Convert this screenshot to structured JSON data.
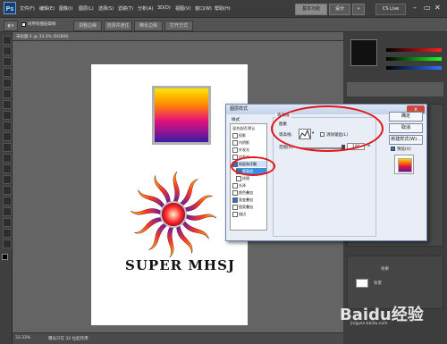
{
  "menubar": {
    "logo": "Ps",
    "items": [
      "文件(F)",
      "编辑(E)",
      "图像(I)",
      "图层(L)",
      "选择(S)",
      "滤镜(T)",
      "分析(A)",
      "3D(D)",
      "视图(V)",
      "窗口(W)",
      "帮助(H)"
    ],
    "workspace": "基本功能",
    "design": "设计",
    "cs_live": "CS Live"
  },
  "options": {
    "sample_all": "对所有图层取样",
    "btn1": "调整边缘",
    "btn2": "选择并遮住",
    "btn3": "精化边缘",
    "btn4": "打开方式"
  },
  "document": {
    "tab": "未标题-1 @ 33.3% (RGB/8)",
    "text": "SUPER MHSJ",
    "zoom": "33.33%",
    "status": "曝光只在 32 位起作用"
  },
  "dialog": {
    "title": "图层样式",
    "close": "x",
    "styles_header": "样式",
    "styles": [
      {
        "label": "混合选项:默认",
        "checked": false,
        "selected": false
      },
      {
        "label": "投影",
        "checked": false,
        "selected": false
      },
      {
        "label": "内阴影",
        "checked": false,
        "selected": false
      },
      {
        "label": "外发光",
        "checked": false,
        "selected": false
      },
      {
        "label": "内发光",
        "checked": false,
        "selected": false
      },
      {
        "label": "斜面和浮雕",
        "checked": true,
        "selected": false
      },
      {
        "label": "等高线",
        "checked": true,
        "selected": true
      },
      {
        "label": "纹理",
        "checked": false,
        "selected": false
      },
      {
        "label": "光泽",
        "checked": false,
        "selected": false
      },
      {
        "label": "颜色叠加",
        "checked": false,
        "selected": false
      },
      {
        "label": "渐变叠加",
        "checked": true,
        "selected": false
      },
      {
        "label": "图案叠加",
        "checked": false,
        "selected": false
      },
      {
        "label": "描边",
        "checked": false,
        "selected": false
      }
    ],
    "section_title": "等高线",
    "section_sub": "图素",
    "contour_label": "等高线:",
    "antialias_label": "消除锯齿(L)",
    "range_label": "范围(R):",
    "range_value": "100",
    "range_unit": "%",
    "range_percent": 100,
    "ok": "确定",
    "cancel": "取消",
    "new_style": "新建样式(W)...",
    "preview": "预览(V)",
    "preview_checked": true
  },
  "panels": {
    "layers_bottom": "背景",
    "layers_effect": "效果"
  },
  "watermark": "Baidu经验",
  "watermark_url": "jingyan.baidu.com"
}
